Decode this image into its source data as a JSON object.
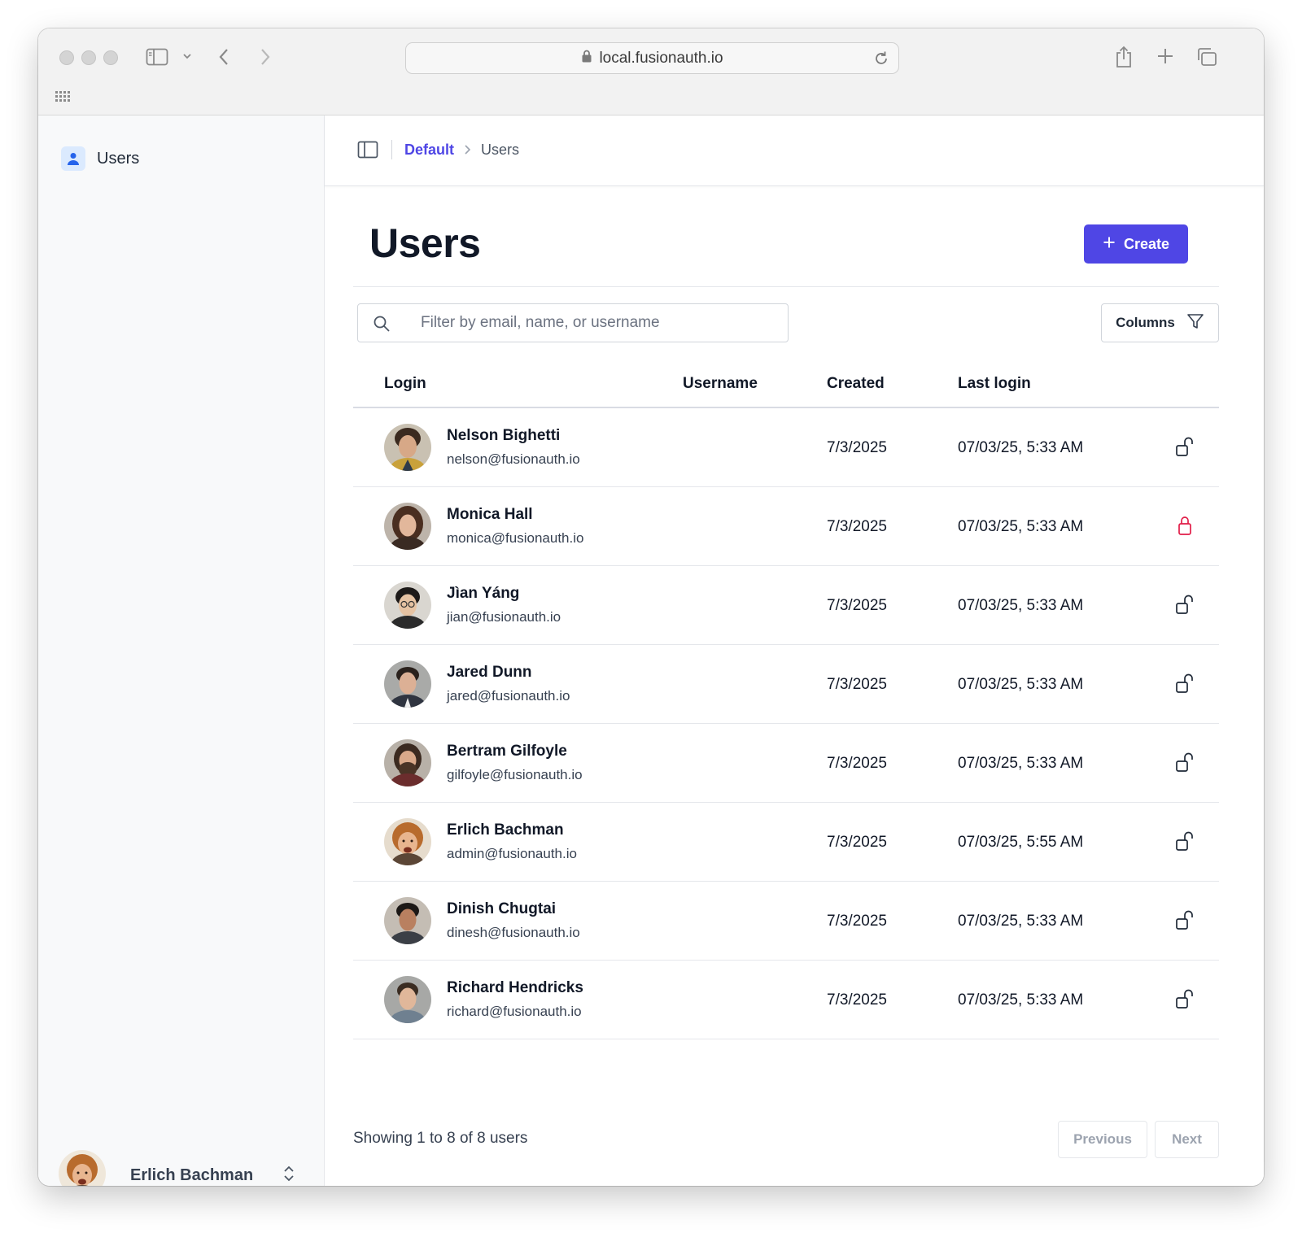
{
  "browser": {
    "url": "local.fusionauth.io"
  },
  "sidebar": {
    "items": [
      {
        "label": "Users",
        "icon": "user-icon"
      }
    ],
    "current_user": {
      "name": "Erlich Bachman"
    }
  },
  "breadcrumb": {
    "parent": "Default",
    "current": "Users"
  },
  "page": {
    "title": "Users",
    "create_label": "Create"
  },
  "search": {
    "placeholder": "Filter by email, name, or username",
    "value": ""
  },
  "columns_label": "Columns",
  "table": {
    "headers": [
      "Login",
      "Username",
      "Created",
      "Last login"
    ],
    "rows": [
      {
        "name": "Nelson Bighetti",
        "email": "nelson@fusionauth.io",
        "username": "",
        "created": "7/3/2025",
        "last_login": "07/03/25, 5:33 AM",
        "locked": false
      },
      {
        "name": "Monica Hall",
        "email": "monica@fusionauth.io",
        "username": "",
        "created": "7/3/2025",
        "last_login": "07/03/25, 5:33 AM",
        "locked": true
      },
      {
        "name": "Jìan Yáng",
        "email": "jian@fusionauth.io",
        "username": "",
        "created": "7/3/2025",
        "last_login": "07/03/25, 5:33 AM",
        "locked": false
      },
      {
        "name": "Jared Dunn",
        "email": "jared@fusionauth.io",
        "username": "",
        "created": "7/3/2025",
        "last_login": "07/03/25, 5:33 AM",
        "locked": false
      },
      {
        "name": "Bertram Gilfoyle",
        "email": "gilfoyle@fusionauth.io",
        "username": "",
        "created": "7/3/2025",
        "last_login": "07/03/25, 5:33 AM",
        "locked": false
      },
      {
        "name": "Erlich Bachman",
        "email": "admin@fusionauth.io",
        "username": "",
        "created": "7/3/2025",
        "last_login": "07/03/25, 5:55 AM",
        "locked": false
      },
      {
        "name": "Dinish Chugtai",
        "email": "dinesh@fusionauth.io",
        "username": "",
        "created": "7/3/2025",
        "last_login": "07/03/25, 5:33 AM",
        "locked": false
      },
      {
        "name": "Richard Hendricks",
        "email": "richard@fusionauth.io",
        "username": "",
        "created": "7/3/2025",
        "last_login": "07/03/25, 5:33 AM",
        "locked": false
      }
    ]
  },
  "pagination": {
    "summary": "Showing 1 to 8 of 8 users",
    "previous_label": "Previous",
    "next_label": "Next"
  },
  "colors": {
    "accent": "#4f46e5",
    "locked": "#e11d48",
    "unlocked": "#1f2937"
  }
}
